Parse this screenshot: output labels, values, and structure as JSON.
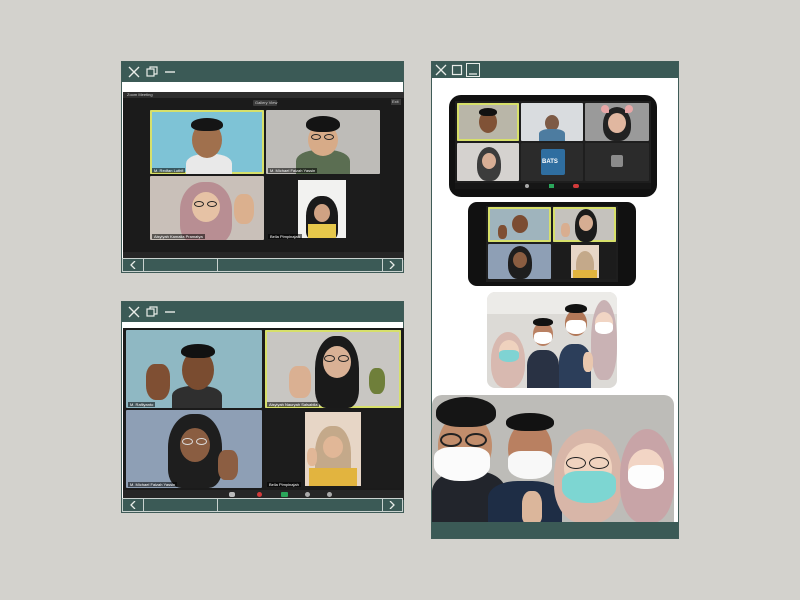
{
  "windows": {
    "top_left": {
      "name": "window-top-left"
    },
    "bottom_left": {
      "name": "window-bottom-left"
    },
    "right": {
      "name": "window-right"
    }
  },
  "zoom_meeting_1": {
    "app_title": "Zoom Meeting",
    "view_label": "Gallery View",
    "exit_label": "Exit",
    "participants": [
      {
        "name": "M. Redfan Luthfi"
      },
      {
        "name": "M. Michael Faizah Yassin"
      },
      {
        "name": "Aisyiyah Kamalia Pramatya"
      },
      {
        "name": "Bella Pimpinajah"
      }
    ]
  },
  "zoom_meeting_2": {
    "participants": [
      {
        "name": "M. Rafliyanto"
      },
      {
        "name": "Aisyiyah Nauryah Salsabila"
      },
      {
        "name": "M. Michael Faizah Yassin"
      },
      {
        "name": "Bella Pimpinajah"
      }
    ]
  },
  "phone_call_1": {
    "center_logo": "BATS"
  },
  "nav": {
    "prev": "<",
    "next": ">"
  },
  "icons": [
    "close-icon",
    "restore-icon",
    "minimize-icon",
    "maximize-icon",
    "chevron-left-icon",
    "chevron-right-icon"
  ],
  "colors": {
    "frame": "#3b5a56",
    "background": "#d3d2cd",
    "active_speaker": "#d7e06a",
    "zoom_bg": "#1b1b1b"
  }
}
